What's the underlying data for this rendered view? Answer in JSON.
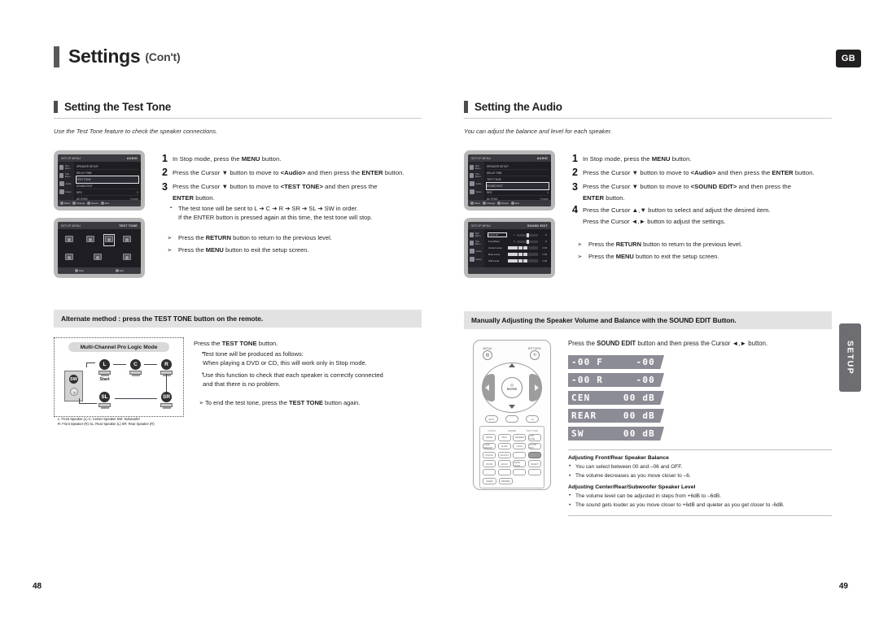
{
  "header": {
    "title": "Settings",
    "subtitle": "(Con't)",
    "region_badge": "GB"
  },
  "side_tab": {
    "label": "SETUP"
  },
  "left": {
    "section": {
      "title": "Setting the Test Tone",
      "description": "Use the Test Tone feature to check the speaker connections."
    },
    "steps": [
      {
        "num": "1",
        "text_html": "In Stop mode, press the <b>MENU</b> button."
      },
      {
        "num": "2",
        "text_html": "Press the Cursor ▼ button to move to <b>&lt;Audio&gt;</b> and then press the <b>ENTER</b> button."
      },
      {
        "num": "3",
        "text_html": "Press the Cursor ▼ button to move to <b>&lt;TEST TONE&gt;</b> and then press the"
      },
      {
        "num": "",
        "text_html": "<b>ENTER</b> button."
      }
    ],
    "bullets": [
      "The test tone will be sent to L ➔ C ➔ R ➔ SR ➔ SL ➔ SW in order.",
      "If the ENTER button is pressed again at this time, the test tone will stop."
    ],
    "notes": [
      "Press the <b>RETURN</b> button to return to the previous level.",
      "Press the <b>MENU</b> button to exit the setup screen."
    ],
    "alt_heading": "Alternate method : press the TEST TONE button on the remote.",
    "diagram": {
      "title": "Multi-Channel Pro Logic Mode",
      "speakers": [
        {
          "id": "L",
          "caption": "Start"
        },
        {
          "id": "C",
          "caption": ""
        },
        {
          "id": "R",
          "caption": ""
        },
        {
          "id": "SR",
          "caption": ""
        },
        {
          "id": "SL",
          "caption": ""
        },
        {
          "id": "SW",
          "caption": ""
        }
      ],
      "legend_line1": "L: Front Speaker (L)   C: Center Speaker      SW: Subwoofer",
      "legend_line2": "R: Front Speaker (R)  SL: Rear Speaker (L)   SR: Rear Speaker (R)"
    },
    "alt_lead_html": "Press the <b>TEST TONE</b> button.",
    "alt_bullets": [
      "Test tone will be produced as follows:",
      "When playing a DVD or CD, this will work only in Stop mode.",
      "Use this function to check that each speaker is correctly connected",
      "and that there is no problem."
    ],
    "alt_note": "To end the test tone, press the <b>TEST TONE</b> button again."
  },
  "right": {
    "section": {
      "title": "Setting the Audio",
      "description": "You can adjust the balance and level for each speaker."
    },
    "steps": [
      {
        "num": "1",
        "text_html": "In Stop mode, press the <b>MENU</b> button."
      },
      {
        "num": "2",
        "text_html": "Press the Cursor ▼ button to move to <b>&lt;Audio&gt;</b> and then press the <b>ENTER</b> button."
      },
      {
        "num": "3",
        "text_html": "Press the Cursor ▼ button to move to <b>&lt;SOUND EDIT&gt;</b> and then press the"
      },
      {
        "num": "",
        "text_html": "<b>ENTER</b> button."
      },
      {
        "num": "4",
        "text_html": "Press the Cursor ▲,▼ button to select and adjust the desired item."
      },
      {
        "num": "",
        "text_html": "Press the Cursor ◄,► button to adjust the settings."
      }
    ],
    "notes": [
      "Press the <b>RETURN</b> button to return to the previous level.",
      "Press the <b>MENU</b> button to exit the setup screen."
    ],
    "grey_heading": "Manually Adjusting the Speaker Volume and Balance with the SOUND EDIT Button.",
    "remote_lead_html": "Press the <b>SOUND EDIT</b> button and then press the Cursor ◄,► button.",
    "remote": {
      "menu_label": "MENU",
      "return_label": "RETURN",
      "enter_label": "ENTER",
      "mid_buttons": [
        "INFO",
        "",
        ""
      ],
      "keypad_group_labels": [
        "P.SCAN",
        "DIMMER",
        "TEST TONE"
      ],
      "keypad_rows": [
        [
          "MODE",
          "DISC",
          "DIMMER",
          "TEST TONE"
        ],
        [
          "CODE MEMORY",
          "SLOW",
          "LOGO",
          "SOUND EDIT"
        ],
        [
          "P.SCAN",
          "ADJUST",
          "",
          ""
        ],
        [
          "ZOOM",
          "ECHO",
          "SLIDE MODE",
          "DIGEST"
        ],
        [
          "",
          "",
          "",
          ""
        ],
        [
          "SLEEP",
          "DIMMER",
          "",
          ""
        ]
      ],
      "highlight_key": "SOUND EDIT"
    },
    "lcd_rows": [
      {
        "left": "-00 F",
        "right": "-00"
      },
      {
        "left": "-00 R",
        "right": "-00"
      },
      {
        "left": "CEN",
        "right": "00 dB"
      },
      {
        "left": "REAR",
        "right": "00 dB"
      },
      {
        "left": "SW",
        "right": "00 dB"
      }
    ],
    "bottom_notes": [
      {
        "title": "Adjusting Front/Rear Speaker Balance",
        "items": [
          "You can select between 00 and –06 and OFF.",
          "The volume decreases as you move closer to –6."
        ]
      },
      {
        "title": "Adjusting Center/Rear/Subwoofer Speaker Level",
        "items": [
          "The volume level can be adjusted in steps from +6dB to –6dB.",
          "The sound gets louder as you move closer to +6dB and quieter as you get closer to -6dB."
        ]
      }
    ]
  },
  "tv_menu_left": {
    "topbar_left": "SETUP MENU",
    "topbar_right": "AUDIO",
    "side_items": [
      "Disc Menu",
      "Title Menu",
      "Audio",
      "Setup"
    ],
    "rows": [
      {
        "label": "SPEAKER SETUP",
        "value": ""
      },
      {
        "label": "DELAY TIME",
        "value": ""
      },
      {
        "label": "TEST TONE",
        "value": "",
        "selected": true
      },
      {
        "label": "SOUND EDIT",
        "value": ""
      },
      {
        "label": "DRC",
        "value": "0"
      },
      {
        "label": "AV SYNC",
        "value": "0 msec"
      }
    ],
    "bottom": [
      "Move",
      "Change",
      "Return",
      "Exit"
    ]
  },
  "tv_testtone": {
    "topbar_left": "SETUP MENU",
    "topbar_right": "TEST TONE",
    "bottom": [
      "Stop",
      "Exit"
    ]
  },
  "tv_menu_right": {
    "topbar_left": "SETUP MENU",
    "topbar_right": "AUDIO",
    "side_items": [
      "Disc Menu",
      "Title Menu",
      "Audio",
      "Setup"
    ],
    "rows": [
      {
        "label": "SPEAKER SETUP",
        "value": ""
      },
      {
        "label": "DELAY TIME",
        "value": ""
      },
      {
        "label": "TEST TONE",
        "value": ""
      },
      {
        "label": "SOUND EDIT",
        "value": "",
        "selected": true
      },
      {
        "label": "DRC",
        "value": "0"
      },
      {
        "label": "AV SYNC",
        "value": "0 msec"
      }
    ],
    "bottom": [
      "Move",
      "Change",
      "Return",
      "Exit"
    ]
  },
  "tv_soundedit": {
    "topbar_left": "SETUP MENU",
    "topbar_right": "SOUND EDIT",
    "rows": [
      {
        "name": "Front L/R",
        "left": "L",
        "right": "R",
        "selected": true
      },
      {
        "name": "Front/Rear",
        "left": "F",
        "right": "R"
      },
      {
        "name": "Center Level",
        "value": "0 dB"
      },
      {
        "name": "Rear Level",
        "value": "0 dB"
      },
      {
        "name": "S/W Level",
        "value": "0 dB"
      }
    ]
  },
  "page_numbers": {
    "left": "48",
    "right": "49"
  }
}
